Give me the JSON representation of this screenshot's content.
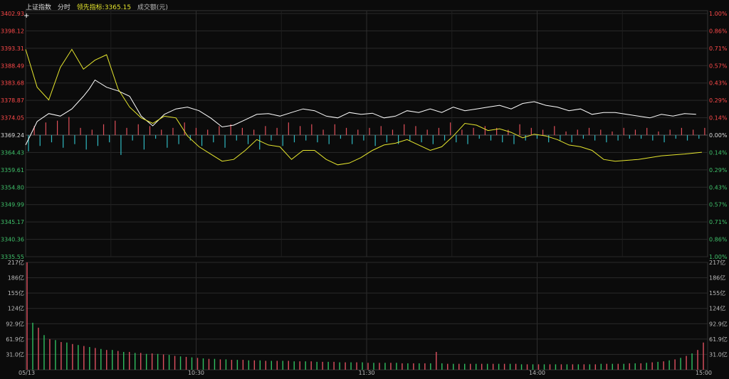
{
  "header": {
    "index_name": "上证指数",
    "mode": "分时",
    "leading_label": "领先指标:",
    "leading_value": "3365.15",
    "volume_label": "成交额(元)"
  },
  "colors": {
    "background": "#0b0b0b",
    "grid": "#2a2a2a",
    "up": "#ff4a4a",
    "down": "#3fc06a",
    "neutral": "#dddddd",
    "price_line": "#ffffff",
    "leading_line": "#e6e62e",
    "up_bar": "#e0505a",
    "down_bar": "#2fb8c0",
    "vol_up": "#e05060",
    "vol_down": "#30c060"
  },
  "chart_data": [
    {
      "type": "line",
      "name": "price",
      "prev_close": 3369.24,
      "ylim": [
        3335.55,
        3402.93
      ],
      "y_ticks_left": [
        "3402.93",
        "3398.12",
        "3393.31",
        "3388.49",
        "3383.68",
        "3378.87",
        "3374.05",
        "3369.24",
        "3364.43",
        "3359.61",
        "3354.80",
        "3349.99",
        "3345.17",
        "3340.36",
        "3335.55"
      ],
      "y_ticks_right": [
        "1.00%",
        "0.86%",
        "0.71%",
        "0.57%",
        "0.43%",
        "0.29%",
        "0.14%",
        "0.00%",
        "0.14%",
        "0.29%",
        "0.43%",
        "0.57%",
        "0.71%",
        "0.86%",
        "1.00%"
      ],
      "x_ticks": [
        "05/13",
        "10:30",
        "11:30",
        "14:00",
        "15:00"
      ],
      "series": [
        {
          "role": "price",
          "values": [
            3366.5,
            3373.0,
            3375.2,
            3374.5,
            3376.5,
            3380.0,
            3382.0,
            3384.5,
            3382.5,
            3381.5,
            3380.0,
            3374.5,
            3371.8,
            3375.0,
            3376.5,
            3377.0,
            3376.0,
            3374.0,
            3371.5,
            3372.0,
            3373.5,
            3375.0,
            3375.2,
            3374.5,
            3375.5,
            3376.5,
            3376.0,
            3374.5,
            3374.0,
            3375.5,
            3375.0,
            3375.3,
            3374.0,
            3374.5,
            3376.0,
            3375.5,
            3376.5,
            3375.5,
            3377.0,
            3376.0,
            3376.5,
            3377.0,
            3377.5,
            3376.5,
            3378.0,
            3378.5,
            3377.5,
            3377.0,
            3376.0,
            3376.5,
            3375.0,
            3375.5,
            3375.5,
            3375.0,
            3374.5,
            3374.0,
            3375.0,
            3374.5,
            3375.2,
            3375.0
          ],
          "x_positions": [
            0,
            2,
            4,
            6,
            8,
            10,
            11,
            12,
            14,
            16,
            18,
            20,
            22,
            24,
            26,
            28,
            30,
            32,
            34,
            36,
            38,
            40,
            42,
            44,
            46,
            48,
            50,
            52,
            54,
            56,
            58,
            60,
            62,
            64,
            66,
            68,
            70,
            72,
            74,
            76,
            78,
            80,
            82,
            84,
            86,
            88,
            90,
            92,
            94,
            96,
            98,
            100,
            102,
            104,
            106,
            108,
            110,
            112,
            114,
            116
          ]
        },
        {
          "role": "leading",
          "values": [
            3393.0,
            3382.5,
            3379.0,
            3388.0,
            3393.0,
            3387.5,
            3390.0,
            3391.5,
            3382.0,
            3377.0,
            3374.0,
            3372.5,
            3374.5,
            3374.0,
            3369.0,
            3366.0,
            3364.0,
            3362.0,
            3362.5,
            3365.0,
            3368.0,
            3366.5,
            3366.0,
            3362.5,
            3365.0,
            3365.0,
            3362.5,
            3361.0,
            3361.5,
            3363.0,
            3365.0,
            3366.5,
            3367.0,
            3368.0,
            3366.5,
            3365.0,
            3366.0,
            3369.0,
            3372.5,
            3372.0,
            3370.5,
            3371.0,
            3370.0,
            3368.5,
            3369.5,
            3369.0,
            3368.0,
            3366.5,
            3366.0,
            3365.0,
            3362.5,
            3362.0,
            3362.5,
            3363.5,
            3364.0,
            3364.5
          ],
          "x_positions": [
            0,
            2,
            4,
            6,
            8,
            10,
            12,
            14,
            16,
            18,
            20,
            22,
            24,
            26,
            28,
            30,
            32,
            34,
            36,
            38,
            40,
            42,
            44,
            46,
            48,
            50,
            52,
            54,
            56,
            58,
            60,
            62,
            64,
            66,
            68,
            70,
            72,
            74,
            76,
            78,
            80,
            82,
            84,
            86,
            88,
            90,
            92,
            94,
            96,
            98,
            100,
            102,
            106,
            110,
            114,
            117
          ]
        }
      ],
      "x_max": 118
    },
    {
      "type": "bar",
      "name": "breadth",
      "note_values": "bar heights in price units above/below prev close",
      "values": [
        -4.5,
        2.5,
        -3,
        3.5,
        -2,
        4,
        -3.5,
        5,
        -2.5,
        2,
        -4,
        1.5,
        -3,
        3,
        -2,
        4,
        -5.5,
        2,
        -1.5,
        3,
        -4,
        2.5,
        -1,
        1.5,
        -3.5,
        2,
        -2.5,
        3.5,
        -1.5,
        2,
        -3,
        1.5,
        -2,
        2.5,
        -3.5,
        3,
        -1.5,
        2,
        -2.5,
        1.5,
        -4,
        2.5,
        -1.5,
        2,
        -3,
        3.5,
        -2,
        2.5,
        -1.5,
        3,
        -2,
        1.5,
        -2.5,
        3,
        -1,
        2,
        -2.5,
        1.5,
        -1.5,
        2,
        -3,
        2.5,
        -2,
        1.5,
        -2.5,
        3,
        -1.5,
        2.5,
        -2,
        1.5,
        -2.5,
        2,
        -1.5,
        3.5,
        -2,
        1.5,
        -2.5,
        2,
        -1,
        2.5,
        -1.5,
        2,
        -2,
        1.5,
        -2.5,
        3,
        -1.5,
        2,
        -1,
        1.5,
        -2,
        2.5,
        -1.5,
        1,
        -2,
        1.5,
        -1,
        2,
        -1.5,
        1.5,
        -2,
        1,
        -1.5,
        2,
        -1,
        1.5,
        -1,
        2,
        -1.5,
        1,
        -2,
        1.5,
        -1,
        2,
        -1.5,
        1.5,
        -1,
        2
      ]
    },
    {
      "type": "bar",
      "name": "volume",
      "ylim": [
        0,
        217
      ],
      "y_ticks": [
        "217亿",
        "186亿",
        "155亿",
        "124亿",
        "92.9亿",
        "61.9亿",
        "31.0亿"
      ],
      "values": [
        217,
        95,
        85,
        70,
        62,
        60,
        56,
        55,
        52,
        50,
        48,
        46,
        44,
        42,
        40,
        40,
        38,
        36,
        36,
        34,
        34,
        32,
        33,
        32,
        31,
        30,
        28,
        27,
        26,
        25,
        24,
        23,
        22,
        22,
        21,
        21,
        20,
        20,
        20,
        19,
        19,
        19,
        18,
        18,
        18,
        18,
        18,
        17,
        17,
        17,
        17,
        16,
        16,
        16,
        16,
        15,
        15,
        15,
        15,
        15,
        14,
        14,
        14,
        14,
        14,
        14,
        13,
        13,
        13,
        13,
        13,
        13,
        36,
        13,
        12,
        12,
        12,
        12,
        12,
        12,
        12,
        12,
        12,
        12,
        12,
        12,
        12,
        11,
        11,
        11,
        11,
        11,
        11,
        11,
        11,
        11,
        11,
        11,
        11,
        11,
        11,
        12,
        12,
        12,
        12,
        12,
        13,
        13,
        13,
        14,
        15,
        16,
        17,
        19,
        21,
        24,
        28,
        33,
        40,
        55
      ],
      "directions": [
        "u",
        "d",
        "u",
        "d",
        "u",
        "d",
        "u",
        "d",
        "u",
        "d",
        "u",
        "d",
        "u",
        "d",
        "u",
        "d",
        "u",
        "d",
        "u",
        "d",
        "u",
        "d",
        "u",
        "d",
        "u",
        "d",
        "u",
        "d",
        "u",
        "d",
        "u",
        "d",
        "u",
        "d",
        "u",
        "d",
        "u",
        "d",
        "u",
        "d",
        "u",
        "d",
        "u",
        "d",
        "u",
        "d",
        "u",
        "d",
        "u",
        "d",
        "u",
        "d",
        "u",
        "d",
        "u",
        "d",
        "u",
        "d",
        "u",
        "d",
        "u",
        "d",
        "u",
        "d",
        "u",
        "d",
        "u",
        "d",
        "u",
        "d",
        "u",
        "d",
        "u",
        "d",
        "u",
        "d",
        "u",
        "d",
        "u",
        "d",
        "u",
        "d",
        "u",
        "d",
        "u",
        "d",
        "u",
        "d",
        "u",
        "d",
        "u",
        "d",
        "u",
        "d",
        "u",
        "d",
        "u",
        "d",
        "u",
        "d",
        "u",
        "d",
        "u",
        "d",
        "u",
        "d",
        "u",
        "d",
        "u",
        "d",
        "u",
        "d",
        "u",
        "d",
        "u",
        "d",
        "u",
        "d",
        "u",
        "u"
      ]
    }
  ]
}
